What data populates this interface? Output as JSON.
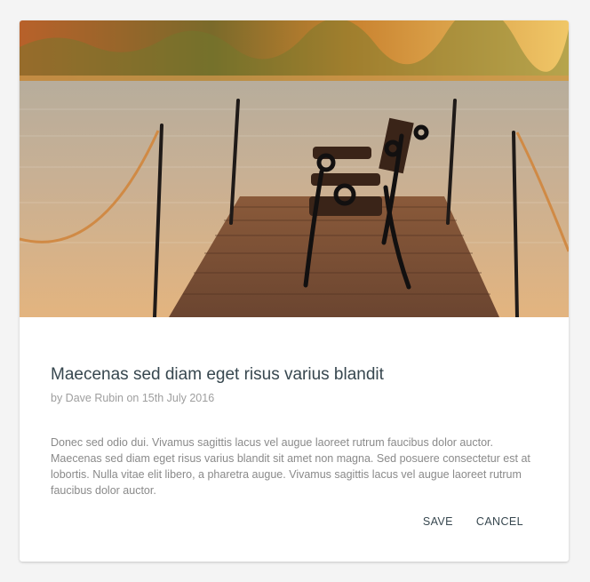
{
  "card": {
    "title": "Maecenas sed diam eget risus varius blandit",
    "byline": "by Dave Rubin on 15th July 2016",
    "body": "Donec sed odio dui. Vivamus sagittis lacus vel augue laoreet rutrum faucibus dolor auctor. Maecenas sed diam eget risus varius blandit sit amet non magna. Sed posuere consectetur est at lobortis. Nulla vitae elit libero, a pharetra augue. Vivamus sagittis lacus vel augue laoreet rutrum faucibus dolor auctor.",
    "actions": {
      "save_label": "SAVE",
      "cancel_label": "CANCEL"
    }
  },
  "colors": {
    "background": "#f4f4f4",
    "card": "#ffffff",
    "title": "#37474f",
    "muted_text": "#8a8a8a"
  }
}
